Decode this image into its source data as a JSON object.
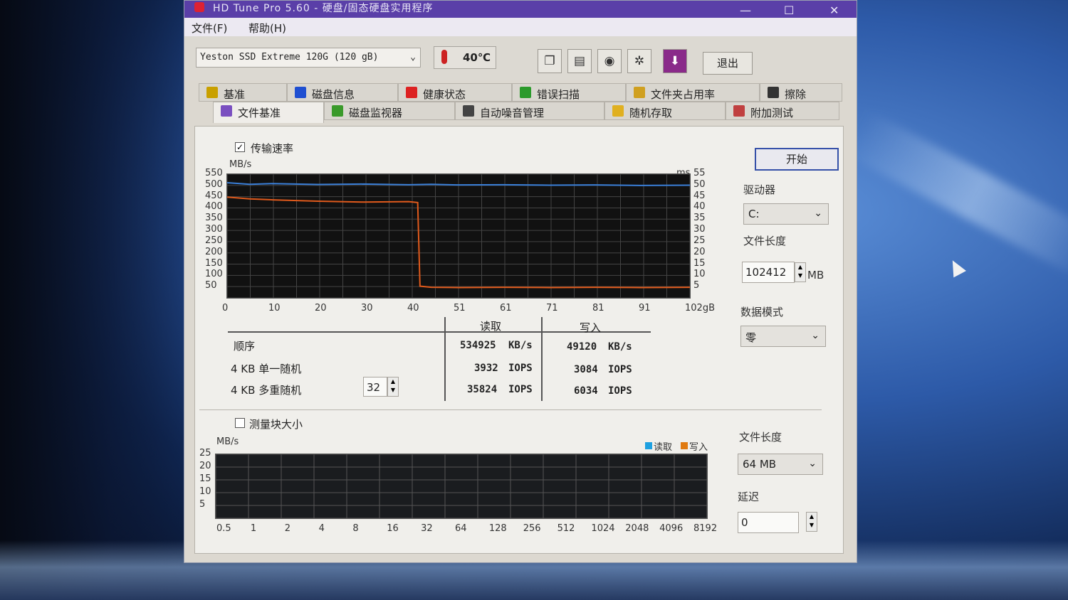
{
  "window": {
    "title": "HD Tune Pro 5.60 - 硬盘/固态硬盘实用程序",
    "minimize": "—",
    "maximize": "☐",
    "close": "✕"
  },
  "menu": {
    "file": "文件(F)",
    "help": "帮助(H)"
  },
  "toolbar": {
    "drive": "Yeston SSD Extreme 120G (120 gB)",
    "temperature": "40℃",
    "exit": "退出",
    "icons": [
      "copy-icon",
      "copy-all-icon",
      "camera-icon",
      "settings-icon",
      "save-icon"
    ]
  },
  "tabs_row1": [
    {
      "label": "基准",
      "icon": "benchmark-icon",
      "color": "#c9a000"
    },
    {
      "label": "磁盘信息",
      "icon": "info-icon",
      "color": "#1f4fd1"
    },
    {
      "label": "健康状态",
      "icon": "health-icon",
      "color": "#d22"
    },
    {
      "label": "错误扫描",
      "icon": "scan-icon",
      "color": "#2b9a2b"
    },
    {
      "label": "文件夹占用率",
      "icon": "folder-icon",
      "color": "#d0a020"
    },
    {
      "label": "擦除",
      "icon": "trash-icon",
      "color": "#333"
    }
  ],
  "tabs_row2": [
    {
      "label": "文件基准",
      "icon": "file-benchmark-icon",
      "color": "#7a4fc0"
    },
    {
      "label": "磁盘监视器",
      "icon": "monitor-icon",
      "color": "#3a9a2a"
    },
    {
      "label": "自动噪音管理",
      "icon": "speaker-icon",
      "color": "#444"
    },
    {
      "label": "随机存取",
      "icon": "random-access-icon",
      "color": "#e0b020"
    },
    {
      "label": "附加测试",
      "icon": "extra-tests-icon",
      "color": "#c04040"
    }
  ],
  "benchmark": {
    "transfer_rate_label": "传输速率",
    "transfer_rate_checked": true,
    "start_label": "开始",
    "drive_label": "驱动器",
    "drive_value": "C:",
    "file_length_label": "文件长度",
    "file_length_value": "102412",
    "file_length_unit": "MB",
    "data_mode_label": "数据模式",
    "data_mode_value": "零"
  },
  "results": {
    "read_header": "读取",
    "write_header": "写入",
    "rows": [
      {
        "label": "顺序",
        "read": "534925",
        "read_unit": "KB/s",
        "write": "49120",
        "write_unit": "KB/s"
      },
      {
        "label": "4 KB 单一随机",
        "read": "3932",
        "read_unit": "IOPS",
        "write": "3084",
        "write_unit": "IOPS"
      },
      {
        "label": "4 KB 多重随机",
        "read": "35824",
        "read_unit": "IOPS",
        "write": "6034",
        "write_unit": "IOPS"
      }
    ],
    "queue_depth": "32"
  },
  "block_size": {
    "label": "测量块大小",
    "checked": false,
    "file_length_label": "文件长度",
    "file_length_value": "64 MB",
    "delay_label": "延迟",
    "delay_value": "0",
    "legend_read": "读取",
    "legend_write": "写入"
  },
  "chart_data": [
    {
      "type": "line",
      "ylabel": "MB/s",
      "y2label": "ms",
      "ylim": [
        0,
        550
      ],
      "y2lim": [
        0,
        55
      ],
      "yticks": [
        550,
        500,
        450,
        400,
        350,
        300,
        250,
        200,
        150,
        100,
        50
      ],
      "y2ticks": [
        55,
        50,
        45,
        40,
        35,
        30,
        25,
        20,
        15,
        10,
        5
      ],
      "xticks": [
        "0",
        "10",
        "20",
        "30",
        "40",
        "51",
        "61",
        "71",
        "81",
        "91",
        "102gB"
      ],
      "xlim": [
        0,
        102
      ],
      "grid": true,
      "series": [
        {
          "color": "#3a7fd8",
          "x": [
            0,
            5,
            10,
            20,
            30,
            40,
            45,
            51,
            61,
            71,
            81,
            91,
            102
          ],
          "y": [
            512,
            505,
            508,
            504,
            506,
            503,
            505,
            502,
            503,
            501,
            502,
            500,
            501
          ]
        },
        {
          "color": "#e05a1c",
          "x": [
            0,
            5,
            10,
            20,
            30,
            40,
            42,
            42.5,
            45,
            51,
            61,
            71,
            81,
            91,
            102
          ],
          "y": [
            448,
            440,
            436,
            430,
            426,
            428,
            424,
            52,
            47,
            46,
            47,
            46,
            47,
            46,
            47
          ]
        }
      ]
    },
    {
      "type": "bar",
      "ylabel": "MB/s",
      "ylim": [
        0,
        25
      ],
      "yticks": [
        25,
        20,
        15,
        10,
        5
      ],
      "categories": [
        "0.5",
        "1",
        "2",
        "4",
        "8",
        "16",
        "32",
        "64",
        "128",
        "256",
        "512",
        "1024",
        "2048",
        "4096",
        "8192"
      ],
      "grid": true,
      "series": [
        {
          "name": "读取",
          "color": "#1ea0e0",
          "values": []
        },
        {
          "name": "写入",
          "color": "#e07a10",
          "values": []
        }
      ]
    }
  ]
}
